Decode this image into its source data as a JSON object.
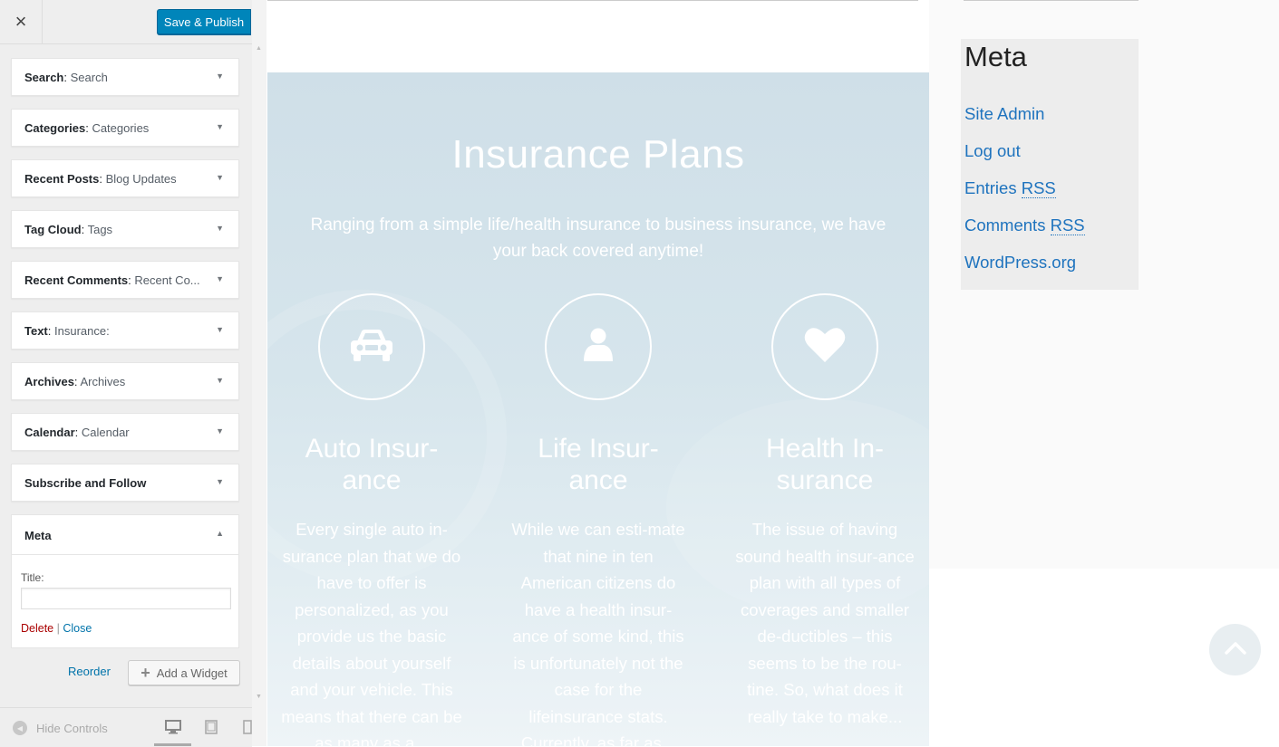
{
  "customizer": {
    "close_label": "×",
    "save_publish": "Save & Publish",
    "widgets": [
      {
        "name": "Search",
        "sep": ": ",
        "subtitle": "Search"
      },
      {
        "name": "Categories",
        "sep": ": ",
        "subtitle": "Categories"
      },
      {
        "name": "Recent Posts",
        "sep": ": ",
        "subtitle": "Blog Updates"
      },
      {
        "name": "Tag Cloud",
        "sep": ": ",
        "subtitle": "Tags"
      },
      {
        "name": "Recent Comments",
        "sep": ": ",
        "subtitle": "Recent Co..."
      },
      {
        "name": "Text",
        "sep": ": ",
        "subtitle": "Insurance:"
      },
      {
        "name": "Archives",
        "sep": ": ",
        "subtitle": "Archives"
      },
      {
        "name": "Calendar",
        "sep": ": ",
        "subtitle": "Calendar"
      },
      {
        "name": "Subscribe and Follow",
        "sep": "",
        "subtitle": ""
      }
    ],
    "meta_widget": {
      "name": "Meta",
      "title_label": "Title:",
      "title_value": "",
      "delete_label": "Delete",
      "separator": "|",
      "close_label": "Close"
    },
    "reorder_label": "Reorder",
    "add_widget_label": "Add a Widget",
    "hide_controls_label": "Hide Controls",
    "devices": [
      "desktop-icon",
      "tablet-icon",
      "mobile-icon"
    ]
  },
  "preview": {
    "title": "Insurance Plans",
    "subtitle": "Ranging from a simple life/health insurance to business insurance, we have your back covered anytime!",
    "columns": [
      {
        "icon": "car-icon",
        "title_line1": "Auto Insur-",
        "title_line2": "ance",
        "text": "Every single auto in-surance plan that we do have to offer is personalized, as you provide us the basic details about yourself and your vehicle. This means that there can be as many as a..."
      },
      {
        "icon": "user-icon",
        "title_line1": "Life Insur-",
        "title_line2": "ance",
        "text": "While we can esti-mate that nine in ten American citizens do have a health insur-ance of some kind, this is unfortunately not the case for the lifeinsurance stats. Currently, as far as..."
      },
      {
        "icon": "heart-icon",
        "title_line1": "Health In-",
        "title_line2": "surance",
        "text": "The issue of having sound health insur-ance plan with all types of coverages and smaller de-ductibles – this seems to be the rou-tine. So, what does it really take to make..."
      }
    ],
    "meta": {
      "heading": "Meta",
      "links": [
        {
          "text": "Site Admin",
          "abbr": ""
        },
        {
          "text": "Log out",
          "abbr": ""
        },
        {
          "text": "Entries ",
          "abbr": "RSS"
        },
        {
          "text": "Comments ",
          "abbr": "RSS"
        },
        {
          "text": "WordPress.org",
          "abbr": ""
        }
      ]
    }
  },
  "colors": {
    "primary_button": "#0085ba",
    "link": "#0073aa",
    "delete": "#aa0000",
    "meta_link": "#1e73be",
    "hero_text": "#ffffff"
  }
}
